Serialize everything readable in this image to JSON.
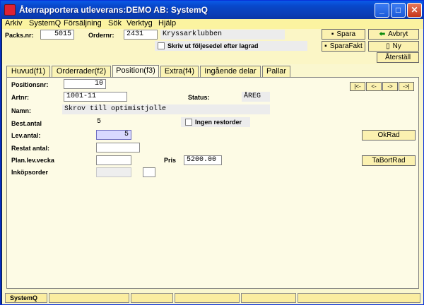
{
  "window": {
    "title": "Återrapportera utleverans:DEMO AB: SystemQ",
    "min_glyph": "_",
    "max_glyph": "□",
    "close_glyph": "✕"
  },
  "menu": [
    "Arkiv",
    "SystemQ",
    "Försäljning",
    "Sök",
    "Verktyg",
    "Hjälp"
  ],
  "header": {
    "packsnr_label": "Packs.nr:",
    "packsnr_value": "5015",
    "ordernr_label": "Ordernr:",
    "ordernr_value": "2431",
    "customer": "Kryssarklubben",
    "print_label": "Skriv ut följesedel efter lagrad"
  },
  "toolbar": {
    "spara": "Spara",
    "sparafakt": "SparaFakt",
    "avbryt": "Avbryt",
    "ny": "Ny",
    "aterstall": "Återställ"
  },
  "tabs": [
    "Huvud(f1)",
    "Orderrader(f2)",
    "Position(f3)",
    "Extra(f4)",
    "Ingående delar",
    "Pallar"
  ],
  "active_tab": "Position(f3)",
  "nav": [
    "|<-",
    "<-",
    "->",
    "->|"
  ],
  "form": {
    "positionsnr_label": "Positionsnr:",
    "positionsnr_value": "10",
    "artnr_label": "Artnr:",
    "artnr_value": "1001-11",
    "status_label": "Status:",
    "status_value": "ÅREG",
    "namn_label": "Namn:",
    "namn_value": "Skrov till optimistjolle",
    "bestantal_label": "Best.antal",
    "bestantal_value": "5",
    "ingen_restorder_label": "Ingen restorder",
    "levantal_label": "Lev.antal:",
    "levantal_value": "5",
    "restantal_label": "Restat antal:",
    "planlev_label": "Plan.lev.vecka",
    "pris_label": "Pris",
    "pris_value": "5200.00",
    "inkopsorder_label": "Inköpsorder"
  },
  "actions": {
    "okrad": "OkRad",
    "tabortrad": "TaBortRad"
  },
  "statusbar": [
    "SystemQ",
    "",
    "",
    "",
    "",
    ""
  ]
}
